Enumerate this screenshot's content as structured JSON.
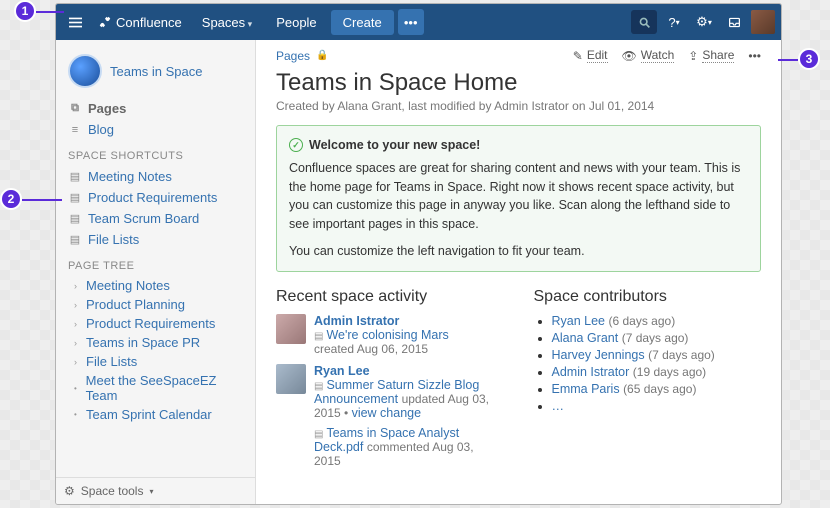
{
  "top": {
    "brand": "Confluence",
    "spaces": "Spaces",
    "people": "People",
    "create": "Create"
  },
  "space": {
    "name": "Teams in Space"
  },
  "side": {
    "pages": "Pages",
    "blog": "Blog",
    "shortcuts_h": "SPACE SHORTCUTS",
    "sc": [
      "Meeting Notes",
      "Product Requirements",
      "Team Scrum Board",
      "File Lists"
    ],
    "tree_h": "PAGE TREE",
    "tree_exp": [
      "Meeting Notes",
      "Product Planning",
      "Product Requirements",
      "Teams in Space PR",
      "File Lists"
    ],
    "tree_leaf": [
      "Meet the SeeSpaceEZ Team",
      "Team Sprint Calendar"
    ],
    "tools": "Space tools"
  },
  "crumbs": {
    "pages": "Pages"
  },
  "actions": {
    "edit": "Edit",
    "watch": "Watch",
    "share": "Share"
  },
  "title": "Teams in Space Home",
  "byline": "Created by Alana Grant, last modified by Admin Istrator on Jul 01, 2014",
  "panel": {
    "title": "Welcome to your new space!",
    "p1": "Confluence spaces are great for sharing content and news with your team. This is the home page for Teams in Space. Right now it shows recent space activity, but you can customize this page in anyway you like. Scan along the lefthand side to see important pages in this space.",
    "p2": "You can customize the left navigation to fit your team."
  },
  "recent": {
    "h": "Recent space activity",
    "items": [
      {
        "user": "Admin Istrator",
        "doc": "We're colonising Mars",
        "meta": "created Aug 06, 2015"
      },
      {
        "user": "Ryan Lee",
        "doc": "Summer Saturn Sizzle Blog Announcement",
        "meta": "updated Aug 03, 2015",
        "extra": "view change",
        "doc2": "Teams in Space Analyst Deck.pdf",
        "meta2": "commented Aug 03, 2015"
      }
    ]
  },
  "contrib": {
    "h": "Space contributors",
    "items": [
      {
        "n": "Ryan Lee",
        "t": "(6 days ago)"
      },
      {
        "n": "Alana Grant",
        "t": "(7 days ago)"
      },
      {
        "n": "Harvey Jennings",
        "t": "(7 days ago)"
      },
      {
        "n": "Admin Istrator",
        "t": "(19 days ago)"
      },
      {
        "n": "Emma Paris",
        "t": "(65 days ago)"
      }
    ],
    "more": "…"
  }
}
